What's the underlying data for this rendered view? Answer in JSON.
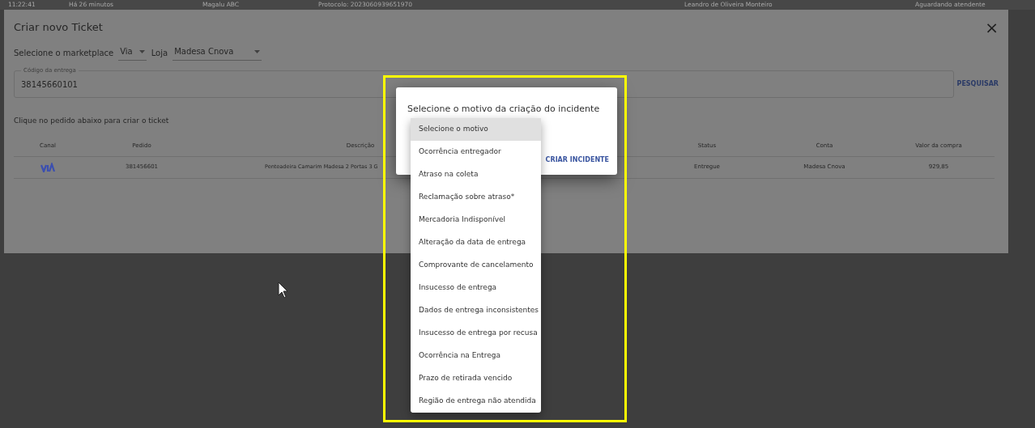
{
  "background_row": [
    "11:22:41",
    "Há 26 minutos",
    "Magalu ABC",
    "Protocolo: 2023060939651970",
    "Leandro de Oliveira Monteiro",
    "Aguardando atendente"
  ],
  "ticket_dialog": {
    "title": "Criar novo Ticket",
    "close": "×",
    "marketplace": {
      "label": "Selecione o marketplace",
      "value": "Via"
    },
    "store": {
      "label": "Loja",
      "value": "Madesa Cnova"
    },
    "delivery_code": {
      "label": "Código da entrega",
      "value": "38145660101"
    },
    "search_button": "PESQUISAR",
    "instruction": "Clique no pedido abaixo para criar o ticket",
    "table": {
      "columns": [
        "Canal",
        "Pedido",
        "Descrição",
        "",
        "Status",
        "Conta",
        "Valor da compra"
      ],
      "rows": [
        {
          "order": "381456601",
          "description": "Penteadeira Camarim Madesa 2 Portas 3 G",
          "status": "Entregue",
          "account": "Madesa Cnova",
          "value": "929,85"
        }
      ]
    }
  },
  "incident_dialog": {
    "title": "Selecione o motivo da criação do incidente",
    "button": "CRIAR INCIDENTE",
    "options": [
      {
        "label": "Selecione o motivo",
        "selected": true
      },
      {
        "label": "Ocorrência entregador",
        "selected": false
      },
      {
        "label": "Atraso na coleta",
        "selected": false
      },
      {
        "label": "Reclamação sobre atraso*",
        "selected": false
      },
      {
        "label": "Mercadoria Indisponível",
        "selected": false
      },
      {
        "label": "Alteração da data de entrega",
        "selected": false
      },
      {
        "label": "Comprovante de cancelamento",
        "selected": false
      },
      {
        "label": "Insucesso de entrega",
        "selected": false
      },
      {
        "label": "Dados de entrega inconsistentes",
        "selected": false
      },
      {
        "label": "Insucesso de entrega por recusa",
        "selected": false
      },
      {
        "label": "Ocorrência na Entrega",
        "selected": false
      },
      {
        "label": "Prazo de retirada vencido",
        "selected": false
      },
      {
        "label": "Região de entrega não atendida",
        "selected": false
      }
    ]
  }
}
